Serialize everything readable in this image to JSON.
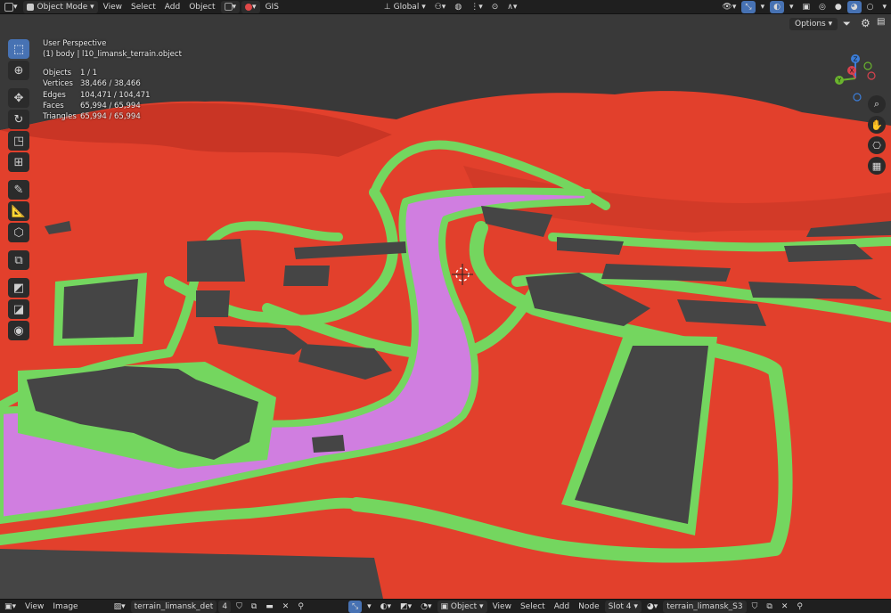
{
  "header": {
    "mode_label": "Object Mode",
    "menus": [
      "View",
      "Select",
      "Add",
      "Object"
    ],
    "gis_label": "GIS",
    "transform_orientation": "Global",
    "options_label": "Options"
  },
  "viewport": {
    "perspective_label": "User Perspective",
    "object_label": "(1) body | l10_limansk_terrain.object",
    "stats": [
      {
        "label": "Objects",
        "value": "1 / 1"
      },
      {
        "label": "Vertices",
        "value": "38,466 / 38,466"
      },
      {
        "label": "Edges",
        "value": "104,471 / 104,471"
      },
      {
        "label": "Faces",
        "value": "65,994 / 65,994"
      },
      {
        "label": "Triangles",
        "value": "65,994 / 65,994"
      }
    ],
    "gizmo_axes": [
      "Z",
      "Y",
      "X"
    ],
    "colors": {
      "terrain": "#e03f2c",
      "road": "#74d65f",
      "building": "#454545",
      "river": "#d07ee0",
      "sky": "#393939"
    }
  },
  "tools": [
    "select-box-icon",
    "cursor-icon",
    "move-icon",
    "rotate-icon",
    "scale-icon",
    "transform-icon",
    "annotate-icon",
    "measure-icon",
    "add-cube-icon",
    "extrude-icon",
    "shade-icon",
    "face-icon",
    "origin-icon"
  ],
  "footer": {
    "menus_left": [
      "View",
      "Image"
    ],
    "image_name": "terrain_limansk_det",
    "user_count": "4",
    "object_label": "Object",
    "menus_right": [
      "View",
      "Select",
      "Add",
      "Node"
    ],
    "slot_label": "Slot 4",
    "material_name": "terrain_limansk_S3"
  }
}
